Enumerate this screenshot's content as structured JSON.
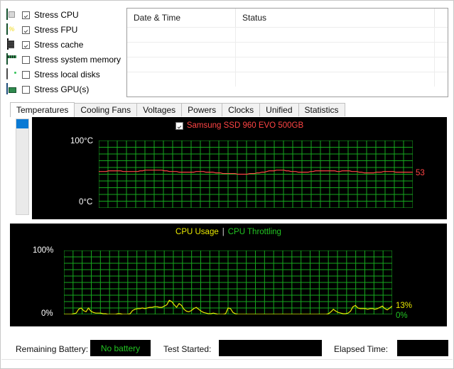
{
  "stress_options": {
    "items": [
      {
        "icon": "cpu-chip-icon",
        "label": "Stress CPU",
        "checked": true
      },
      {
        "icon": "fpu-percent-icon",
        "label": "Stress FPU",
        "checked": true
      },
      {
        "icon": "cache-chip-icon",
        "label": "Stress cache",
        "checked": true
      },
      {
        "icon": "memory-module-icon",
        "label": "Stress system memory",
        "checked": false
      },
      {
        "icon": "hard-disk-icon",
        "label": "Stress local disks",
        "checked": false
      },
      {
        "icon": "gpu-card-icon",
        "label": "Stress GPU(s)",
        "checked": false
      }
    ]
  },
  "log_table": {
    "columns": [
      "Date & Time",
      "Status",
      ""
    ],
    "rows": [
      [
        "",
        "",
        ""
      ],
      [
        "",
        "",
        ""
      ],
      [
        "",
        "",
        ""
      ],
      [
        "",
        "",
        ""
      ]
    ]
  },
  "tabs": {
    "items": [
      {
        "label": "Temperatures",
        "active": true
      },
      {
        "label": "Cooling Fans",
        "active": false
      },
      {
        "label": "Voltages",
        "active": false
      },
      {
        "label": "Powers",
        "active": false
      },
      {
        "label": "Clocks",
        "active": false
      },
      {
        "label": "Unified",
        "active": false
      },
      {
        "label": "Statistics",
        "active": false
      }
    ]
  },
  "bottom_bar": {
    "battery_label": "Remaining Battery:",
    "battery_value": "No battery",
    "test_started_label": "Test Started:",
    "test_started_value": "",
    "elapsed_label": "Elapsed Time:",
    "elapsed_value": ""
  },
  "colors": {
    "plot_background": "#000000",
    "grid": "#16a81e",
    "temp_series": "#ff4444",
    "cpu_usage": "#e8e800",
    "cpu_throttling": "#22c422",
    "axis_text": "#ffffff",
    "selection": "#0a7ad4"
  },
  "chart_data": [
    {
      "type": "line",
      "name": "temperature-chart",
      "title": "Samsung SSD 960 EVO 500GB",
      "title_checked": true,
      "ylabel": "",
      "xlabel": "",
      "ylim": [
        0,
        100
      ],
      "ytick_labels": [
        "100°C",
        "0°C"
      ],
      "yticks": [
        100,
        0
      ],
      "grid": true,
      "current_value_label": "53",
      "series": [
        {
          "name": "Samsung SSD 960 EVO 500GB",
          "color": "#ff4444",
          "unit": "°C",
          "values": [
            54,
            54,
            54,
            54,
            55,
            55,
            55,
            55,
            55,
            55,
            54,
            54,
            54,
            54,
            54,
            54,
            54,
            55,
            55,
            56,
            56,
            56,
            56,
            56,
            56,
            56,
            56,
            55,
            55,
            54,
            54,
            54,
            54,
            53,
            53,
            53,
            53,
            53,
            53,
            53,
            54,
            54,
            54,
            54,
            53,
            53,
            53,
            53,
            52,
            52,
            52,
            51,
            51,
            51,
            51,
            51,
            51,
            50,
            50,
            50,
            50,
            50,
            51,
            51,
            51,
            52,
            52,
            53,
            53,
            54,
            55,
            55,
            55,
            56,
            56,
            56,
            56,
            55,
            55,
            54,
            54,
            54,
            53,
            53,
            53,
            53,
            53,
            54,
            54,
            55,
            55,
            55,
            55,
            55,
            55,
            55,
            55,
            55,
            54,
            54,
            55,
            55,
            55,
            55,
            54,
            54,
            54,
            53,
            53,
            52,
            52,
            52,
            52,
            52,
            53,
            53,
            53,
            54,
            54,
            54,
            54,
            54,
            53,
            53,
            53,
            53,
            53,
            53,
            53,
            53
          ]
        }
      ]
    },
    {
      "type": "line",
      "name": "cpu-usage-chart",
      "title_parts": [
        {
          "text": "CPU Usage",
          "color": "#e8e800"
        },
        {
          "text": "|",
          "color": "#ffffff"
        },
        {
          "text": "CPU Throttling",
          "color": "#22c422"
        }
      ],
      "ylabel": "",
      "xlabel": "",
      "ylim": [
        0,
        100
      ],
      "ytick_labels": [
        "100%",
        "0%"
      ],
      "yticks": [
        100,
        0
      ],
      "grid": true,
      "right_labels": [
        {
          "text": "13%",
          "color": "#e8e800"
        },
        {
          "text": "0%",
          "color": "#22c422"
        }
      ],
      "series": [
        {
          "name": "CPU Usage",
          "color": "#e8e800",
          "unit": "%",
          "values": [
            0,
            0,
            0,
            0,
            1,
            2,
            8,
            10,
            6,
            4,
            10,
            5,
            3,
            2,
            2,
            2,
            1,
            1,
            0,
            0,
            0,
            0,
            1,
            1,
            0,
            0,
            0,
            1,
            6,
            8,
            9,
            9,
            10,
            9,
            10,
            11,
            11,
            12,
            12,
            11,
            11,
            13,
            15,
            22,
            20,
            15,
            11,
            17,
            14,
            8,
            5,
            4,
            6,
            9,
            11,
            8,
            5,
            3,
            2,
            1,
            1,
            2,
            1,
            0,
            0,
            0,
            1,
            10,
            9,
            3,
            1,
            0,
            0,
            0,
            0,
            0,
            0,
            0,
            0,
            0,
            0,
            0,
            0,
            0,
            0,
            0,
            0,
            0,
            0,
            0,
            0,
            0,
            0,
            0,
            0,
            0,
            0,
            0,
            0,
            0,
            0,
            0,
            0,
            0,
            0,
            0,
            0,
            0,
            1,
            4,
            8,
            5,
            3,
            2,
            1,
            1,
            2,
            5,
            12,
            14,
            10,
            9,
            9,
            9,
            8,
            9,
            9,
            8,
            9,
            11,
            13,
            9,
            7,
            10,
            13
          ]
        },
        {
          "name": "CPU Throttling",
          "color": "#22c422",
          "unit": "%",
          "values": [
            0,
            0,
            0,
            0,
            0,
            0,
            0,
            0,
            0,
            0,
            0,
            0,
            0,
            0,
            0,
            0,
            0,
            0,
            0,
            0,
            0,
            0,
            0,
            0,
            0,
            0,
            0,
            0,
            0,
            0,
            0,
            0,
            0,
            0,
            0,
            0,
            0,
            0,
            0,
            0,
            0,
            0,
            0,
            0,
            0,
            0,
            0,
            0,
            0,
            0,
            0,
            0,
            0,
            0,
            0,
            0,
            0,
            0,
            0,
            0,
            0,
            0,
            0,
            0,
            0,
            0,
            0,
            0,
            0,
            0,
            0,
            0,
            0,
            0,
            0,
            0,
            0,
            0,
            0,
            0,
            0,
            0,
            0,
            0,
            0,
            0,
            0,
            0,
            0,
            0,
            0,
            0,
            0,
            0,
            0,
            0,
            0,
            0,
            0,
            0,
            0,
            0,
            0,
            0,
            0,
            0,
            0,
            0,
            0,
            0,
            0,
            0,
            0,
            0,
            0,
            0,
            0,
            0,
            0,
            0,
            0,
            0,
            0,
            0,
            0,
            0,
            0,
            0,
            0
          ]
        }
      ]
    }
  ]
}
